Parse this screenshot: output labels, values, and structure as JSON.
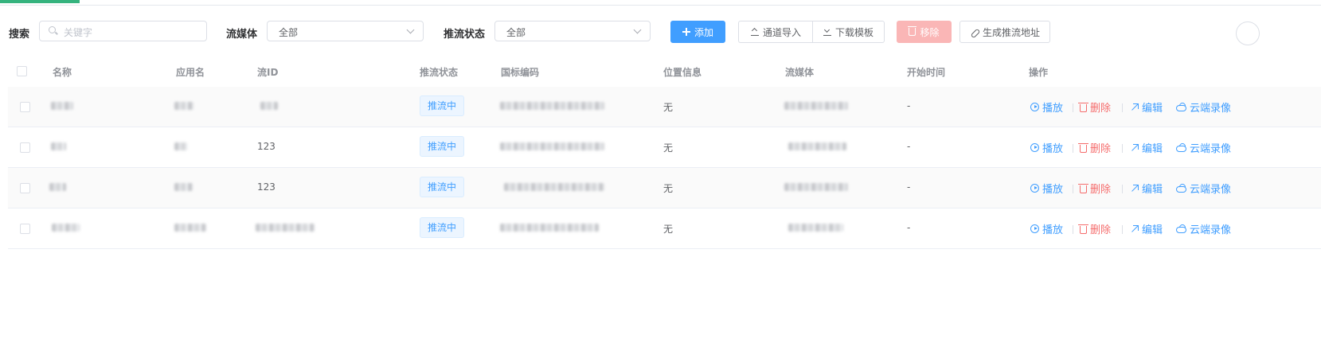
{
  "filters": {
    "search_label": "搜索",
    "search_placeholder": "关键字",
    "media_label": "流媒体",
    "media_value": "全部",
    "push_status_label": "推流状态",
    "push_status_value": "全部"
  },
  "toolbar": {
    "add": "添加",
    "import_channel": "通道导入",
    "download_template": "下载模板",
    "remove": "移除",
    "generate_push_url": "生成推流地址"
  },
  "table": {
    "columns": [
      "名称",
      "应用名",
      "流ID",
      "推流状态",
      "国标编码",
      "位置信息",
      "流媒体",
      "开始时间",
      "操作"
    ],
    "rows": [
      {
        "stream_id": "",
        "status": "推流中",
        "location": "无",
        "start_time": "-"
      },
      {
        "stream_id": "123",
        "status": "推流中",
        "location": "无",
        "start_time": "-"
      },
      {
        "stream_id": "123",
        "status": "推流中",
        "location": "无",
        "start_time": "-"
      },
      {
        "stream_id": "",
        "status": "推流中",
        "location": "无",
        "start_time": "-"
      }
    ],
    "actions": {
      "play": "播放",
      "delete": "删除",
      "edit": "编辑",
      "cloud_record": "云端录像"
    }
  },
  "colors": {
    "primary": "#409eff",
    "danger": "#f56c6c",
    "tag_bg": "#ecf5ff",
    "active_tab": "#35b37e"
  }
}
